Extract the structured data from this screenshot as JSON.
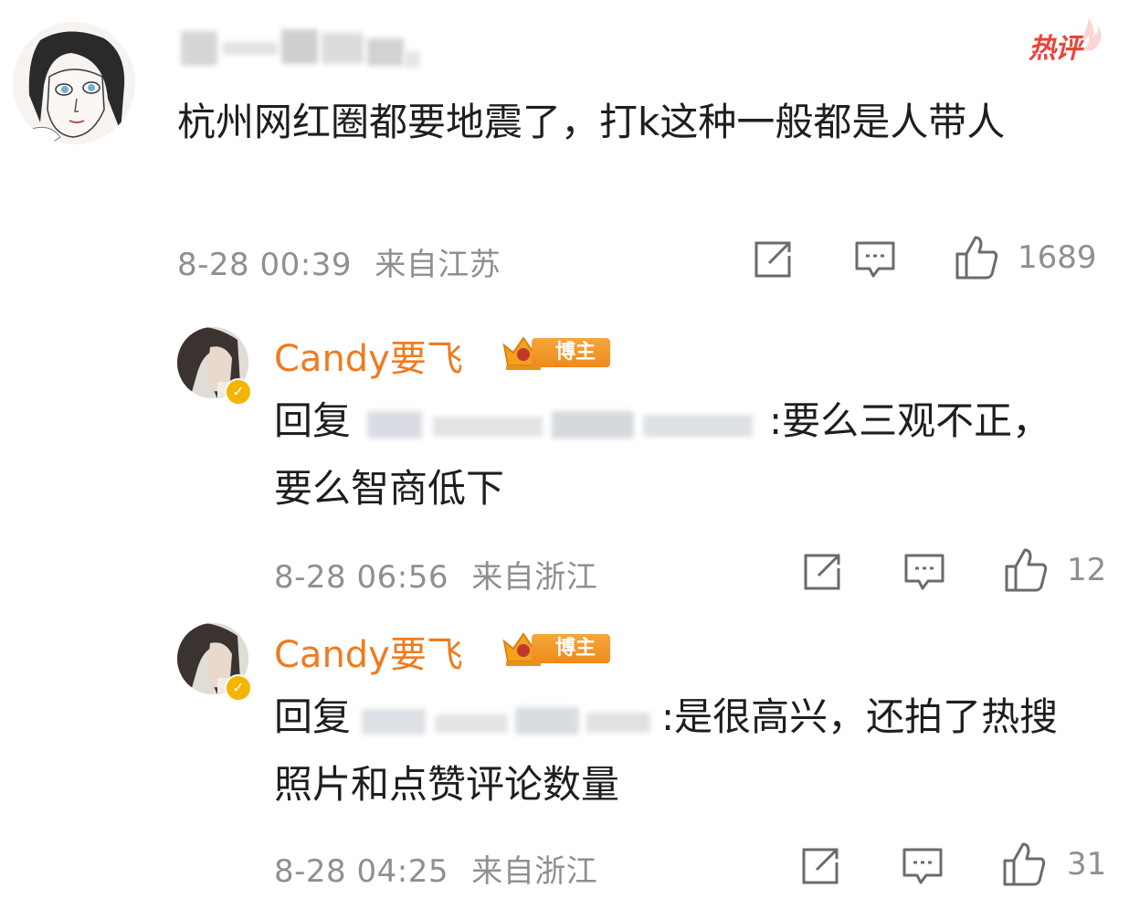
{
  "comment": {
    "hot_label": "热评",
    "text": "杭州网红圈都要地震了，打k这种一般都是人带人",
    "timestamp": "8-28 00:39",
    "location": "来自江苏",
    "likes": "1689"
  },
  "replies": [
    {
      "author": "Candy要飞",
      "badge": "博主",
      "reply_prefix": "回复",
      "text": ":要么三观不正，要么智商低下",
      "timestamp": "8-28 06:56",
      "location": "来自浙江",
      "likes": "12"
    },
    {
      "author": "Candy要飞",
      "badge": "博主",
      "reply_prefix": "回复",
      "text": ":是很高兴，还拍了热搜照片和点赞评论数量",
      "timestamp": "8-28 04:25",
      "location": "来自浙江",
      "likes": "31"
    }
  ],
  "colors": {
    "author": "#ef7b20",
    "meta": "#8f8f8f",
    "hot": "#e8463a",
    "badge": "#ee8a1c"
  },
  "icons": [
    "repost-icon",
    "comment-icon",
    "like-icon",
    "verified-icon",
    "crown-icon"
  ]
}
